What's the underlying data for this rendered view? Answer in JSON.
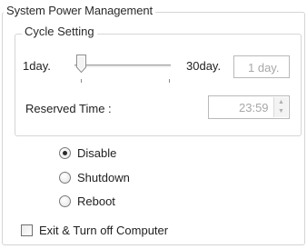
{
  "group": {
    "title": "System Power Management"
  },
  "cycle": {
    "title": "Cycle Setting",
    "min_label": "1day.",
    "max_label": "30day.",
    "value_text": "1 day.",
    "slider_value": 1,
    "slider_min": 1,
    "slider_max": 30,
    "reserved_label": "Reserved Time :",
    "reserved_value": "23:59"
  },
  "options": {
    "selected": "disable",
    "items": [
      {
        "id": "disable",
        "label": "Disable"
      },
      {
        "id": "shutdown",
        "label": "Shutdown"
      },
      {
        "id": "reboot",
        "label": "Reboot"
      }
    ]
  },
  "exit_checkbox": {
    "label": "Exit & Turn off Computer",
    "checked": false
  },
  "icons": {
    "spin_up": "chevron-up-icon",
    "spin_down": "chevron-down-icon"
  },
  "colors": {
    "border": "#d5d5d5",
    "disabled_text": "#a8a8a8",
    "text": "#222222"
  }
}
